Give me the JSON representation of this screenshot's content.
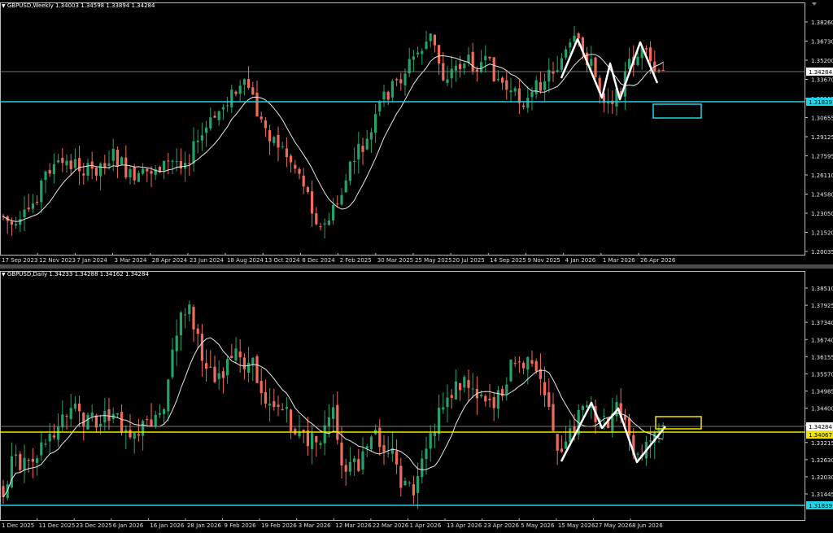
{
  "colors": {
    "background": "#000000",
    "bull": "#26a269",
    "bear": "#ef6b5a",
    "ma": "#e6e6e6",
    "grid_frame": "#bbbbbb",
    "cyan": "#22d3e6",
    "yellow": "#f2e600",
    "pattern": "#ffffff"
  },
  "weekly": {
    "title": "GBPUSD,Weekly  1.34003 1.34598 1.33894 1.34284",
    "price_axis": [
      "1.38260",
      "1.36730",
      "1.35200",
      "1.33670",
      "1.32185",
      "1.30655",
      "1.29125",
      "1.27595",
      "1.26110",
      "1.24580",
      "1.23050",
      "1.21520",
      "1.20035"
    ],
    "current_price_tag": "1.34284",
    "level_tag": "1.31839",
    "date_axis": [
      "17 Sep 2023",
      "12 Nov 2023",
      "7 Jan 2024",
      "3 Mar 2024",
      "28 Apr 2024",
      "23 Jun 2024",
      "18 Aug 2024",
      "13 Oct 2024",
      "8 Dec 2024",
      "2 Feb 2025",
      "30 Mar 2025",
      "25 May 2025",
      "20 Jul 2025",
      "14 Sep 2025",
      "9 Nov 2025",
      "4 Jan 2026",
      "1 Mar 2026",
      "26 Apr 2026"
    ]
  },
  "daily": {
    "title": "GBPUSD,Daily  1.34233 1.34288 1.34162 1.34284",
    "price_axis": [
      "1.38510",
      "1.37925",
      "1.37340",
      "1.36740",
      "1.36155",
      "1.35570",
      "1.34985",
      "1.34400",
      "1.33800",
      "1.33215",
      "1.32630",
      "1.32030",
      "1.31445"
    ],
    "current_price_tag": "1.34284",
    "level_tag_yellow": "1.34067",
    "level_tag_cyan": "1.31839",
    "date_axis": [
      "1 Dec 2025",
      "11 Dec 2025",
      "23 Dec 2025",
      "6 Jan 2026",
      "16 Jan 2026",
      "28 Jan 2026",
      "9 Feb 2026",
      "19 Feb 2026",
      "3 Mar 2026",
      "12 Mar 2026",
      "22 Mar 2026",
      "1 Apr 2026",
      "13 Apr 2026",
      "23 Apr 2026",
      "5 May 2026",
      "15 May 2026",
      "27 May 2026",
      "8 Jun 2026"
    ]
  }
}
